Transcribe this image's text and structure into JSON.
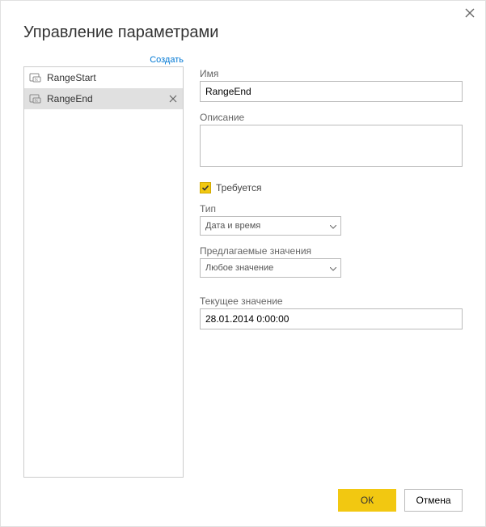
{
  "dialog": {
    "title": "Управление параметрами",
    "create_link": "Создать"
  },
  "sidebar": {
    "items": [
      {
        "label": "RangeStart",
        "selected": false
      },
      {
        "label": "RangeEnd",
        "selected": true
      }
    ]
  },
  "form": {
    "name_label": "Имя",
    "name_value": "RangeEnd",
    "description_label": "Описание",
    "description_value": "",
    "required_label": "Требуется",
    "required_checked": true,
    "type_label": "Тип",
    "type_value": "Дата и время",
    "suggested_label": "Предлагаемые значения",
    "suggested_value": "Любое значение",
    "current_label": "Текущее значение",
    "current_value": "28.01.2014 0:00:00"
  },
  "footer": {
    "ok": "ОК",
    "cancel": "Отмена"
  }
}
